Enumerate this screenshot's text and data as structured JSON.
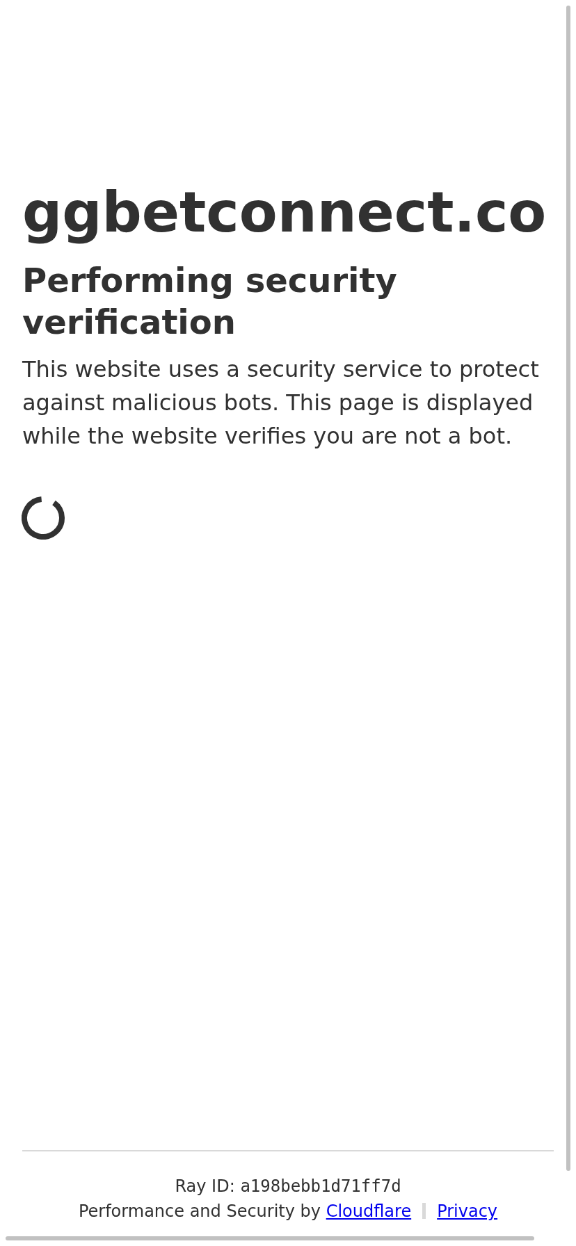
{
  "page": {
    "domain": "ggbetconnect.co",
    "title": "Performing security verification",
    "description": "This website uses a security service to protect against malicious bots. This page is displayed while the website verifies you are not a bot."
  },
  "footer": {
    "ray_id_label": "Ray ID:",
    "ray_id": "a198bebb1d71ff7d",
    "credit": "Performance and Security by",
    "links": [
      {
        "label": "Cloudflare"
      },
      {
        "label": "Privacy"
      }
    ]
  }
}
